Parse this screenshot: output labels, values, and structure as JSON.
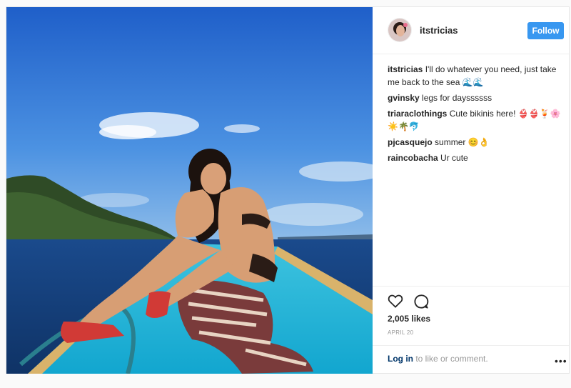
{
  "post": {
    "author": {
      "username": "itstricias",
      "follow_label": "Follow"
    },
    "comments": [
      {
        "user": "itstricias",
        "text": "I'll do whatever you need, just take me back to the sea 🌊🌊"
      },
      {
        "user": "gvinsky",
        "text": "legs for dayssssss"
      },
      {
        "user": "triaraclothings",
        "text": "Cute bikinis here! 👙👙🍹🌸☀️🌴🐬"
      },
      {
        "user": "pjcasquejo",
        "text": "summer 😊👌"
      },
      {
        "user": "raincobacha",
        "text": "Ur cute"
      }
    ],
    "likes": "2,005 likes",
    "date": "APRIL 20",
    "login": {
      "link": "Log in",
      "rest": " to like or comment."
    }
  },
  "icons": {
    "like": "heart-outline-icon",
    "comment": "speech-bubble-icon",
    "more": "more-options-icon"
  },
  "colors": {
    "follow_button": "#3897f0",
    "sky": "#2f79d6",
    "sea": "#1d4f8f",
    "boat": "#1ba3c7"
  }
}
